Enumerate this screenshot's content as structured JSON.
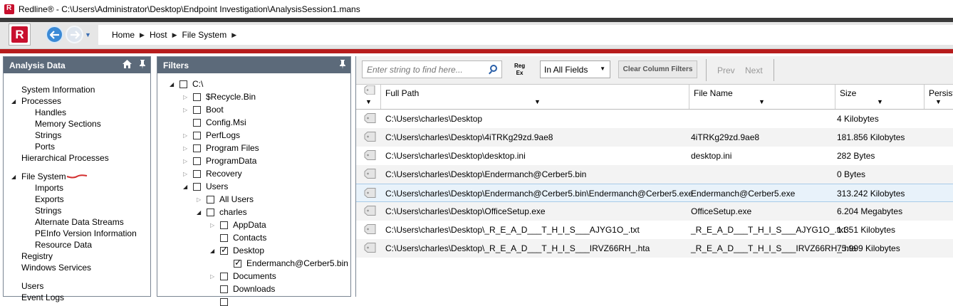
{
  "window": {
    "title": "Redline® - C:\\Users\\Administrator\\Desktop\\Endpoint Investigation\\AnalysisSession1.mans"
  },
  "toolbar": {
    "logo_letter": "R",
    "breadcrumb": [
      "Home",
      "Host",
      "File System"
    ]
  },
  "analysis_panel": {
    "header": "Analysis Data",
    "items": [
      {
        "label": "System Information",
        "level": 0,
        "expander": "none"
      },
      {
        "label": "Processes",
        "level": 0,
        "expander": "open"
      },
      {
        "label": "Handles",
        "level": 1,
        "expander": "none"
      },
      {
        "label": "Memory Sections",
        "level": 1,
        "expander": "none"
      },
      {
        "label": "Strings",
        "level": 1,
        "expander": "none"
      },
      {
        "label": "Ports",
        "level": 1,
        "expander": "none"
      },
      {
        "label": "Hierarchical Processes",
        "level": 0,
        "expander": "none"
      },
      {
        "label": "File System",
        "level": 0,
        "expander": "open"
      },
      {
        "label": "Imports",
        "level": 1,
        "expander": "none"
      },
      {
        "label": "Exports",
        "level": 1,
        "expander": "none"
      },
      {
        "label": "Strings",
        "level": 1,
        "expander": "none"
      },
      {
        "label": "Alternate Data Streams",
        "level": 1,
        "expander": "none"
      },
      {
        "label": "PEInfo Version Information",
        "level": 1,
        "expander": "none"
      },
      {
        "label": "Resource Data",
        "level": 1,
        "expander": "none"
      },
      {
        "label": "Registry",
        "level": 0,
        "expander": "none"
      },
      {
        "label": "Windows Services",
        "level": 0,
        "expander": "none"
      },
      {
        "label": "Users",
        "level": 0,
        "expander": "none"
      },
      {
        "label": "Event Logs",
        "level": 0,
        "expander": "none"
      }
    ]
  },
  "filters_panel": {
    "header": "Filters",
    "items": [
      {
        "label": "C:\\",
        "level": 0,
        "expander": "open",
        "checked": false
      },
      {
        "label": "$Recycle.Bin",
        "level": 1,
        "expander": "closed",
        "checked": false
      },
      {
        "label": "Boot",
        "level": 1,
        "expander": "closed",
        "checked": false
      },
      {
        "label": "Config.Msi",
        "level": 1,
        "expander": "none",
        "checked": false
      },
      {
        "label": "PerfLogs",
        "level": 1,
        "expander": "closed",
        "checked": false
      },
      {
        "label": "Program Files",
        "level": 1,
        "expander": "closed",
        "checked": false
      },
      {
        "label": "ProgramData",
        "level": 1,
        "expander": "closed",
        "checked": false
      },
      {
        "label": "Recovery",
        "level": 1,
        "expander": "closed",
        "checked": false
      },
      {
        "label": "Users",
        "level": 1,
        "expander": "open",
        "checked": false
      },
      {
        "label": "All Users",
        "level": 2,
        "expander": "closed",
        "checked": false
      },
      {
        "label": "charles",
        "level": 2,
        "expander": "open",
        "checked": false
      },
      {
        "label": "AppData",
        "level": 3,
        "expander": "closed",
        "checked": false
      },
      {
        "label": "Contacts",
        "level": 3,
        "expander": "none",
        "checked": false
      },
      {
        "label": "Desktop",
        "level": 3,
        "expander": "open",
        "checked": true
      },
      {
        "label": "Endermanch@Cerber5.bin",
        "level": 4,
        "expander": "none",
        "checked": true
      },
      {
        "label": "Documents",
        "level": 3,
        "expander": "closed",
        "checked": false
      },
      {
        "label": "Downloads",
        "level": 3,
        "expander": "none",
        "checked": false
      },
      {
        "label": "",
        "level": 3,
        "expander": "none",
        "checked": false
      }
    ]
  },
  "search": {
    "placeholder": "Enter string to find here...",
    "regex_top": "Reg",
    "regex_bottom": "Ex",
    "scope": "In All Fields",
    "clear_label": "Clear Column Filters",
    "prev_label": "Prev",
    "next_label": "Next"
  },
  "grid": {
    "columns": [
      "Full Path",
      "File Name",
      "Size",
      "Persist"
    ],
    "rows": [
      {
        "path": "C:\\Users\\charles\\Desktop",
        "name": "",
        "size": "4 Kilobytes"
      },
      {
        "path": "C:\\Users\\charles\\Desktop\\4iTRKg29zd.9ae8",
        "name": "4iTRKg29zd.9ae8",
        "size": "181.856 Kilobytes"
      },
      {
        "path": "C:\\Users\\charles\\Desktop\\desktop.ini",
        "name": "desktop.ini",
        "size": "282 Bytes"
      },
      {
        "path": "C:\\Users\\charles\\Desktop\\Endermanch@Cerber5.bin",
        "name": "",
        "size": "0 Bytes"
      },
      {
        "path": "C:\\Users\\charles\\Desktop\\Endermanch@Cerber5.bin\\Endermanch@Cerber5.exe",
        "name": "Endermanch@Cerber5.exe",
        "size": "313.242 Kilobytes"
      },
      {
        "path": "C:\\Users\\charles\\Desktop\\OfficeSetup.exe",
        "name": "OfficeSetup.exe",
        "size": "6.204 Megabytes"
      },
      {
        "path": "C:\\Users\\charles\\Desktop\\_R_E_A_D___T_H_I_S___AJYG1O_.txt",
        "name": "_R_E_A_D___T_H_I_S___AJYG1O_.txt",
        "size": "1.351 Kilobytes"
      },
      {
        "path": "C:\\Users\\charles\\Desktop\\_R_E_A_D___T_H_I_S___IRVZ66RH_.hta",
        "name": "_R_E_A_D___T_H_I_S___IRVZ66RH_.hta",
        "size": "75.999 Kilobytes"
      }
    ],
    "selected_row": 4
  },
  "colors": {
    "accent_red": "#b71c1c",
    "panel_header": "#5c6a7a",
    "annotation_red": "#d32f2f"
  }
}
